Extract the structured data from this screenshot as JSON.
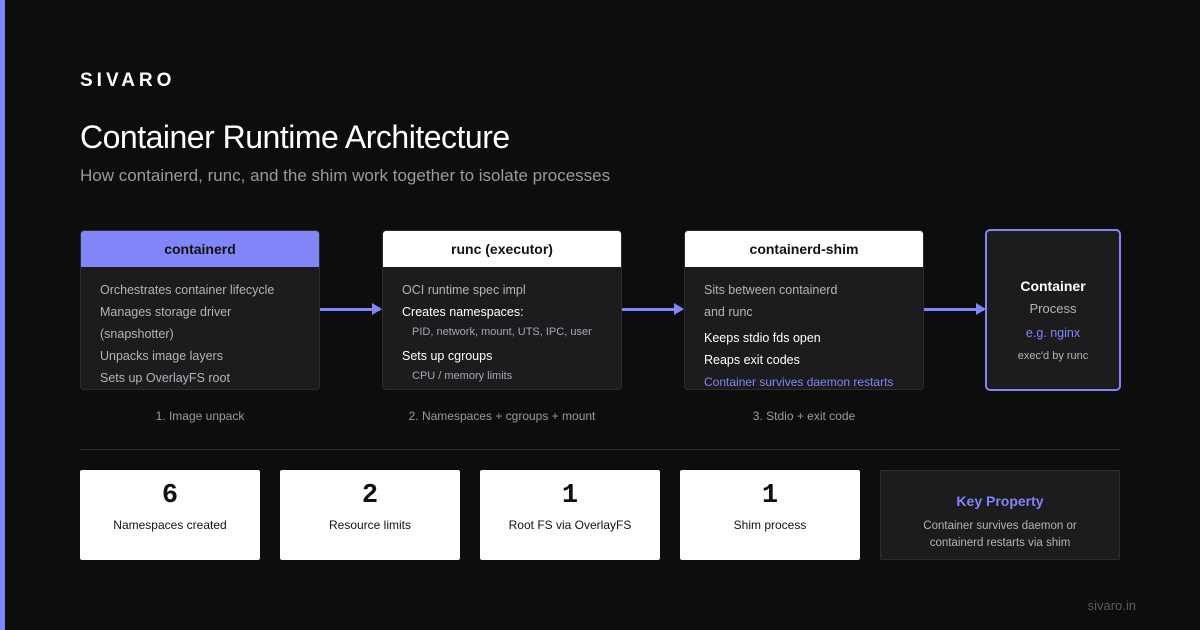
{
  "brand": "SIVARO",
  "title": "Container Runtime Architecture",
  "subtitle": "How containerd, runc, and the shim work together to isolate processes",
  "colors": {
    "accent": "#8185f8",
    "background": "#0d0d0d",
    "card": "#1c1c1e"
  },
  "components": [
    {
      "name": "containerd",
      "lines": [
        "Orchestrates container lifecycle",
        "Manages storage driver",
        "(snapshotter)",
        "Unpacks image layers",
        "Sets up OverlayFS root"
      ]
    },
    {
      "name": "runc (executor)",
      "lines": [
        "OCI runtime spec impl",
        "Creates namespaces:",
        "PID, network, mount, UTS, IPC, user",
        "Sets up cgroups",
        "CPU / memory limits"
      ]
    },
    {
      "name": "containerd-shim",
      "lines": [
        "Sits between containerd",
        "and runc",
        "Keeps stdio fds open",
        "Reaps exit codes",
        "Container survives daemon restarts"
      ]
    }
  ],
  "container": {
    "title": "Container",
    "subtitle": "Process",
    "example": "e.g. nginx",
    "note": "exec'd by runc"
  },
  "steps": [
    "1. Image unpack",
    "2. Namespaces + cgroups + mount",
    "3. Stdio + exit code"
  ],
  "stats": [
    {
      "value": "6",
      "label": "Namespaces created"
    },
    {
      "value": "2",
      "label": "Resource limits"
    },
    {
      "value": "1",
      "label": "Root FS via OverlayFS"
    },
    {
      "value": "1",
      "label": "Shim process"
    }
  ],
  "key_property": {
    "title": "Key Property",
    "lines": [
      "Container survives daemon or",
      "containerd restarts via shim"
    ]
  },
  "footer": "sivaro.in"
}
